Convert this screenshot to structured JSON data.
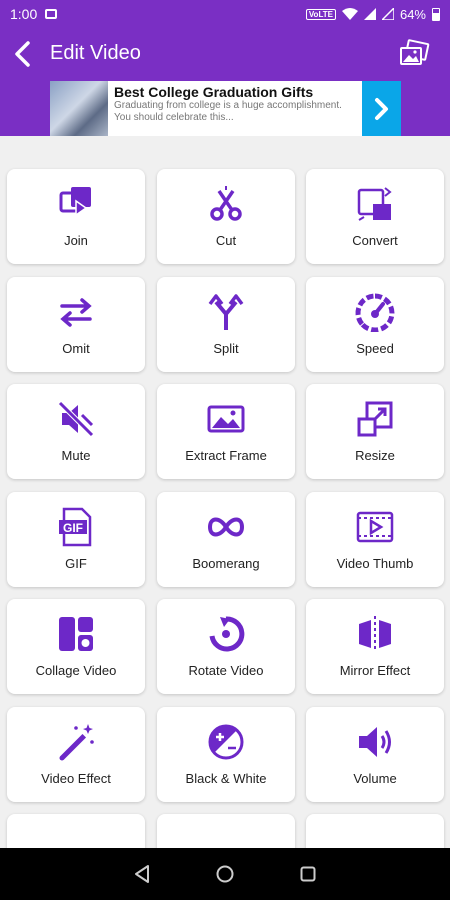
{
  "status_bar": {
    "time": "1:00",
    "network": "VoLTE",
    "battery": "64%"
  },
  "header": {
    "title": "Edit Video"
  },
  "ad": {
    "title": "Best College Graduation Gifts",
    "body": "Graduating from college is a huge accomplishment. You should celebrate this..."
  },
  "tools": [
    {
      "label": "Join",
      "icon": "join-icon"
    },
    {
      "label": "Cut",
      "icon": "scissors-icon"
    },
    {
      "label": "Convert",
      "icon": "convert-icon"
    },
    {
      "label": "Omit",
      "icon": "omit-arrows-icon"
    },
    {
      "label": "Split",
      "icon": "split-icon"
    },
    {
      "label": "Speed",
      "icon": "speedometer-icon"
    },
    {
      "label": "Mute",
      "icon": "mute-icon"
    },
    {
      "label": "Extract Frame",
      "icon": "image-icon"
    },
    {
      "label": "Resize",
      "icon": "resize-icon"
    },
    {
      "label": "GIF",
      "icon": "gif-file-icon"
    },
    {
      "label": "Boomerang",
      "icon": "infinity-icon"
    },
    {
      "label": "Video Thumb",
      "icon": "video-thumb-icon"
    },
    {
      "label": "Collage Video",
      "icon": "collage-icon"
    },
    {
      "label": "Rotate Video",
      "icon": "rotate-icon"
    },
    {
      "label": "Mirror Effect",
      "icon": "mirror-icon"
    },
    {
      "label": "Video Effect",
      "icon": "magic-wand-icon"
    },
    {
      "label": "Black & White",
      "icon": "contrast-icon"
    },
    {
      "label": "Volume",
      "icon": "volume-icon"
    }
  ],
  "colors": {
    "accent": "#7a2fc4",
    "icon": "#6d28c8",
    "ad_arrow": "#0aa6e8"
  }
}
